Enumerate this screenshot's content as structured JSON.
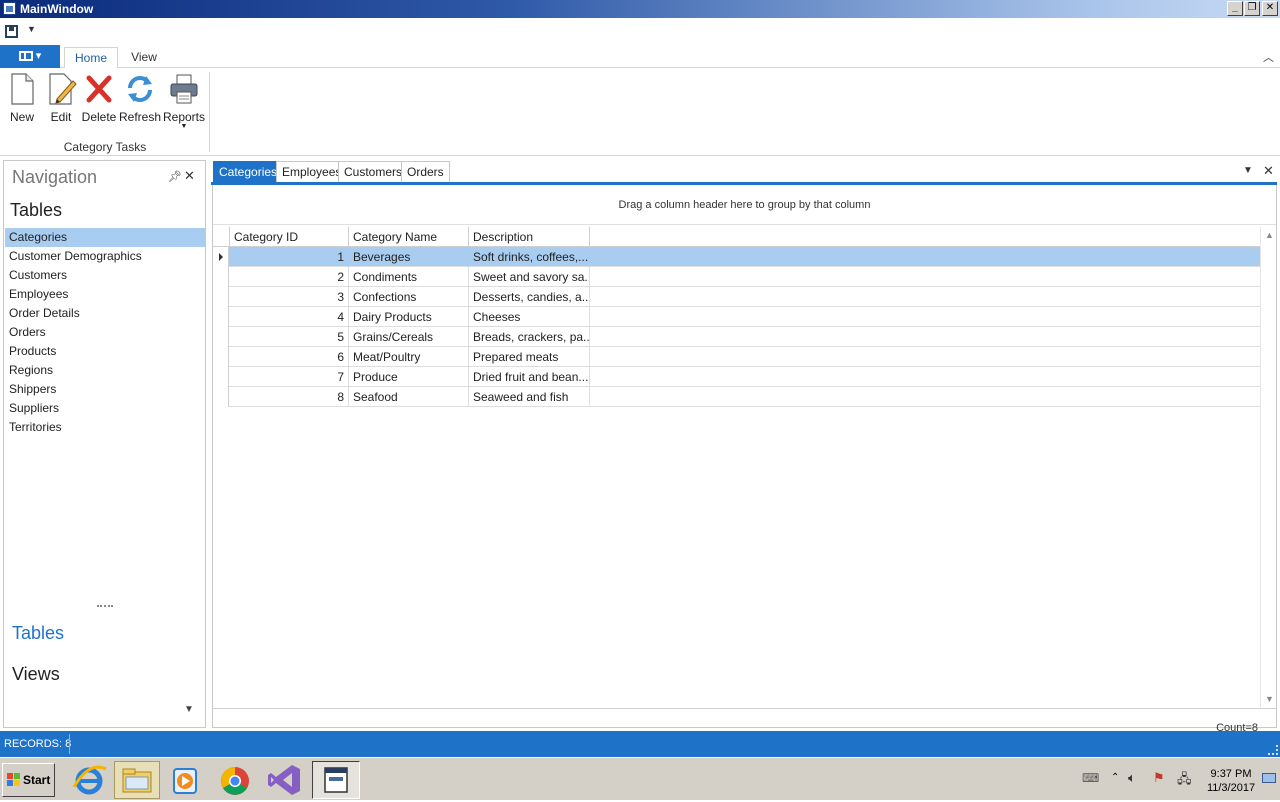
{
  "window": {
    "title": "MainWindow"
  },
  "ribbon": {
    "tabs": [
      {
        "label": "Home",
        "active": true
      },
      {
        "label": "View",
        "active": false
      }
    ],
    "buttons": [
      {
        "label": "New",
        "icon": "new-document-icon"
      },
      {
        "label": "Edit",
        "icon": "edit-pencil-icon"
      },
      {
        "label": "Delete",
        "icon": "delete-x-icon"
      },
      {
        "label": "Refresh",
        "icon": "refresh-icon"
      },
      {
        "label": "Reports",
        "icon": "printer-icon"
      }
    ],
    "group_label": "Category Tasks"
  },
  "navigation": {
    "caption": "Navigation",
    "group_title": "Tables",
    "items": [
      {
        "label": "Categories",
        "selected": true
      },
      {
        "label": "Customer Demographics"
      },
      {
        "label": "Customers"
      },
      {
        "label": "Employees"
      },
      {
        "label": "Order Details"
      },
      {
        "label": "Orders"
      },
      {
        "label": "Products"
      },
      {
        "label": "Regions"
      },
      {
        "label": "Shippers"
      },
      {
        "label": "Suppliers"
      },
      {
        "label": "Territories"
      }
    ],
    "groups": [
      {
        "label": "Tables",
        "active": true
      },
      {
        "label": "Views",
        "active": false
      }
    ]
  },
  "document": {
    "tabs": [
      {
        "label": "Categories",
        "active": true
      },
      {
        "label": "Employees"
      },
      {
        "label": "Customers"
      },
      {
        "label": "Orders"
      }
    ],
    "group_panel_text": "Drag a column header here to group by that column",
    "columns": [
      "Category ID",
      "Category Name",
      "Description"
    ],
    "rows": [
      {
        "id": "1",
        "name": "Beverages",
        "description": "Soft drinks, coffees,...",
        "selected": true
      },
      {
        "id": "2",
        "name": "Condiments",
        "description": "Sweet and savory sa..."
      },
      {
        "id": "3",
        "name": "Confections",
        "description": "Desserts, candies, a..."
      },
      {
        "id": "4",
        "name": "Dairy Products",
        "description": "Cheeses"
      },
      {
        "id": "5",
        "name": "Grains/Cereals",
        "description": "Breads, crackers, pa..."
      },
      {
        "id": "6",
        "name": "Meat/Poultry",
        "description": "Prepared meats"
      },
      {
        "id": "7",
        "name": "Produce",
        "description": "Dried fruit and bean..."
      },
      {
        "id": "8",
        "name": "Seafood",
        "description": "Seaweed and fish"
      }
    ],
    "count_text": "Count=8"
  },
  "statusbar": {
    "records": "RECORDS: 8"
  },
  "taskbar": {
    "start_label": "Start",
    "apps": [
      "internet-explorer-icon",
      "file-explorer-icon",
      "media-player-icon",
      "chrome-icon",
      "visual-studio-icon",
      "app-window-icon"
    ],
    "clock_time": "9:37 PM",
    "clock_date": "11/3/2017"
  },
  "colors": {
    "accent": "#1e73c8",
    "selection": "#a9cdf0",
    "delete_red": "#d9302a"
  }
}
